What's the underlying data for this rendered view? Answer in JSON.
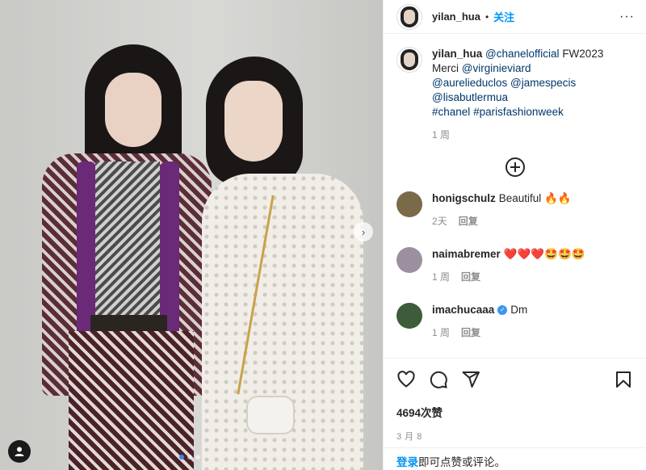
{
  "post": {
    "author": "yilan_hua",
    "separator": "•",
    "follow_label": "关注",
    "more_label": "···",
    "caption": {
      "user": "yilan_hua",
      "mention_1": "@chanelofficial",
      "text_1": " FW2023",
      "text_2": "Merci ",
      "mention_2": "@virginieviard",
      "mention_3": "@aurelieduclos",
      "mention_4": "@jamespecis",
      "mention_5": "@lisabutlermua",
      "hashtag_1": "#chanel",
      "hashtag_2": "#parisfashionweek",
      "time": "1 周"
    },
    "likes": "4694次赞",
    "date": "3 月 8",
    "login_link": "登录",
    "login_text": "即可点赞或评论。"
  },
  "comments": [
    {
      "user": "honigschulz",
      "text": "Beautiful 🔥🔥",
      "time": "2天",
      "reply": "回复",
      "verified": false,
      "avatar_color": "#7b6a4a"
    },
    {
      "user": "naimabremer",
      "text": "❤️❤️❤️🤩🤩🤩",
      "time": "1 周",
      "reply": "回复",
      "verified": false,
      "avatar_color": "#9b8fa0"
    },
    {
      "user": "imachucaaa",
      "text": "Dm",
      "time": "1 周",
      "reply": "回复",
      "verified": true,
      "avatar_color": "#3c5c3a"
    }
  ],
  "carousel": {
    "slides": 3,
    "active_index": 0
  },
  "icons": [
    "heart-icon",
    "comment-icon",
    "share-icon",
    "bookmark-icon",
    "add-comment-icon",
    "next-icon",
    "tag-user-icon"
  ],
  "colors": {
    "link": "#00376b",
    "follow": "#0095f6",
    "muted": "#8e8e8e",
    "verified": "#3897f0"
  }
}
